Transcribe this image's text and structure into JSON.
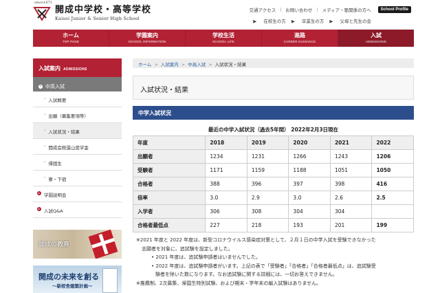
{
  "header": {
    "logo_since": "since1871",
    "logo_jp": "開成中学校・高等学校",
    "logo_en": "Kaisei Junior & Senior High School",
    "links_top": [
      "交通アクセス",
      "お問い合わせ",
      "メディア・塾関係の方へ"
    ],
    "profile_button": "School Profile",
    "links_bottom": [
      "在校生の方",
      "卒業生の方",
      "父母と先生の会"
    ]
  },
  "gnav": [
    {
      "jp": "ホーム",
      "en": "TOP PAGE"
    },
    {
      "jp": "学園案内",
      "en": "SCHOOL INFORMATION"
    },
    {
      "jp": "学校生活",
      "en": "SCHOOL LIFE"
    },
    {
      "jp": "進路",
      "en": "CAREER GUIDANCE"
    },
    {
      "jp": "入試",
      "en": "ADMISSIONS"
    }
  ],
  "sidebar": {
    "head_jp": "入試案内",
    "head_en": "ADMISSIONS",
    "current": "中高入試",
    "subitems": [
      "入試概要",
      "出願（募集要項等）",
      "入試状況・結果",
      "開成会館還山奨学金",
      "帰国生",
      "寮・下宿"
    ],
    "main_items": [
      "学園説明会",
      "入試Q&A"
    ],
    "banner1_text": "開成の教育",
    "banner2_title": "開成の未来を創る",
    "banner2_sub": "～新校舎建築計画～"
  },
  "breadcrumb": [
    "ホーム",
    "入試案内",
    "中高入試",
    "入試状況・結果"
  ],
  "page_title": "入試状況・結果",
  "section_title": "中学入試状況",
  "table": {
    "caption": "最近の中学入試状況（過去5年間） 2022年2月3日現在",
    "header_label": "年度",
    "years": [
      "2018",
      "2019",
      "2020",
      "2021",
      "2022"
    ],
    "rows": [
      {
        "label": "出願者",
        "values": [
          "1234",
          "1231",
          "1266",
          "1243",
          "1206"
        ]
      },
      {
        "label": "受験者",
        "values": [
          "1171",
          "1159",
          "1188",
          "1051",
          "1050"
        ]
      },
      {
        "label": "合格者",
        "values": [
          "388",
          "396",
          "397",
          "398",
          "416"
        ]
      },
      {
        "label": "倍率",
        "values": [
          "3.0",
          "2.9",
          "3.0",
          "2.6",
          "2.5"
        ]
      },
      {
        "label": "入学者",
        "values": [
          "306",
          "308",
          "304",
          "304",
          ""
        ]
      },
      {
        "label": "合格者最低点",
        "values": [
          "227",
          "218",
          "193",
          "201",
          "199"
        ]
      }
    ]
  },
  "notes": {
    "n1_a": "※2021 年度と 2022 年度は、新型コロナウイルス感染症対策として、２月１日の中学入試を受験できなかった",
    "n1_b": "志願者を対象に、追試験を設定しました。",
    "b1": "2021 年度は、追試験申請者はいませんでした。",
    "b2_a": "2022 年度は、追試験申請者がいます。上記の表で「受験者」「合格者」「合格者最低点」は、追試験受",
    "b2_b": "験者を除いた数になります。なお追試験に関する詳細には、一切お答えできません。",
    "n2": "※推薦制、2次募集、帰国生特別試験、および期末・学年末の編入試験はありません。"
  }
}
